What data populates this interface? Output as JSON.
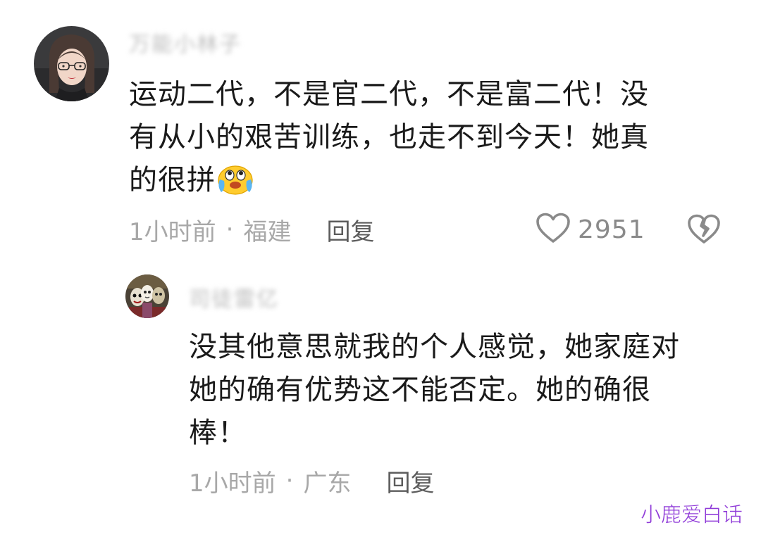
{
  "comment": {
    "username": "万能小林子",
    "text_lines": [
      "运动二代，不是官二代，不是富二代！没",
      "有从小的艰苦训练，也走不到今天！她真",
      "的很拼"
    ],
    "emoji_icon": "crying-laughing-emoji-icon",
    "time": "1小时前",
    "separator": "·",
    "location": "福建",
    "reply_label": "回复",
    "like_count": "2951",
    "like_icon": "heart-outline-icon",
    "dislike_icon": "broken-heart-icon"
  },
  "reply": {
    "username": "司徒雷亿",
    "text_lines": [
      "没其他意思就我的个人感觉，她家庭对",
      "她的确有优势这不能否定。她的确很",
      "棒！"
    ],
    "time": "1小时前",
    "separator": "·",
    "location": "广东",
    "reply_label": "回复"
  },
  "watermark": "小鹿爱白话",
  "colors": {
    "text": "#1a1a1a",
    "meta": "#a8a8a8",
    "reply_button": "#5c5c5c",
    "watermark": "#8f3ad8"
  }
}
